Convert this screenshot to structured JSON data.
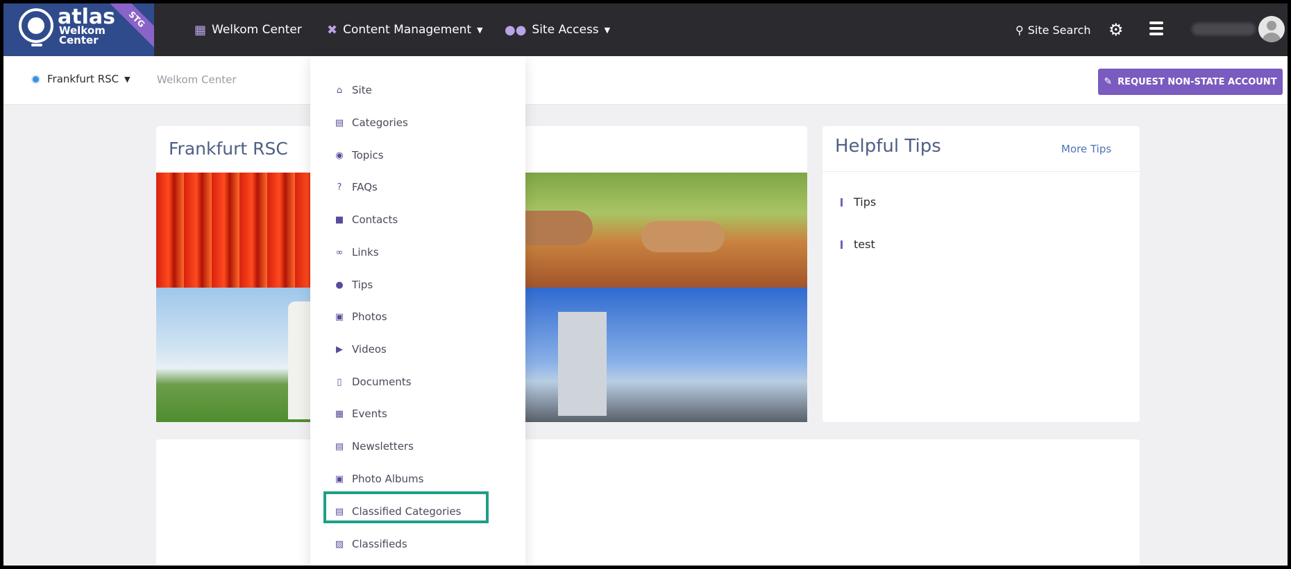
{
  "logo": {
    "brand": "atlas",
    "sub_line1": "Welkom",
    "sub_line2": "Center",
    "env_badge": "STG"
  },
  "nav": {
    "items": [
      {
        "label": "Welkom Center",
        "icon": "people-icon"
      },
      {
        "label": "Content Management",
        "icon": "tools-icon"
      },
      {
        "label": "Site Access",
        "icon": "users-icon"
      }
    ],
    "site_search": "Site Search"
  },
  "subbar": {
    "site_selector": "Frankfurt RSC",
    "breadcrumb": "Welkom Center",
    "request_button": "REQUEST NON-STATE ACCOUNT"
  },
  "main": {
    "title": "Frankfurt RSC"
  },
  "tips": {
    "title": "Helpful Tips",
    "more_link": "More Tips",
    "items": [
      "Tips",
      "test"
    ]
  },
  "dropdown": {
    "items": [
      {
        "label": "Site",
        "icon": "home-icon"
      },
      {
        "label": "Categories",
        "icon": "list-icon"
      },
      {
        "label": "Topics",
        "icon": "comments-icon"
      },
      {
        "label": "FAQs",
        "icon": "question-icon"
      },
      {
        "label": "Contacts",
        "icon": "contact-icon"
      },
      {
        "label": "Links",
        "icon": "link-icon"
      },
      {
        "label": "Tips",
        "icon": "lightbulb-icon"
      },
      {
        "label": "Photos",
        "icon": "images-icon"
      },
      {
        "label": "Videos",
        "icon": "video-icon"
      },
      {
        "label": "Documents",
        "icon": "file-icon"
      },
      {
        "label": "Events",
        "icon": "calendar-icon"
      },
      {
        "label": "Newsletters",
        "icon": "newspaper-icon"
      },
      {
        "label": "Photo Albums",
        "icon": "book-icon"
      },
      {
        "label": "Classified Categories",
        "icon": "list-icon"
      },
      {
        "label": "Classifieds",
        "icon": "clipboard-icon"
      }
    ]
  },
  "colors": {
    "topbar": "#2b2a2f",
    "accent": "#7a5bbf",
    "highlight": "#1f9e86",
    "title": "#4f5f85"
  }
}
